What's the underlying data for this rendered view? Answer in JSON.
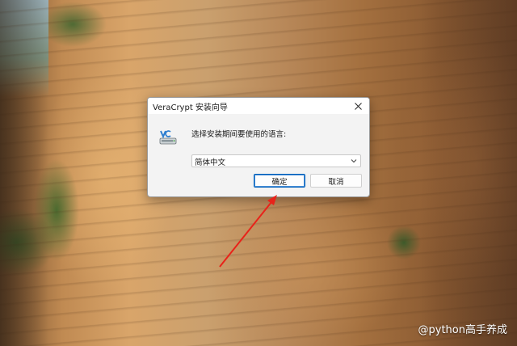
{
  "dialog": {
    "title": "VeraCrypt 安装向导",
    "prompt": "选择安装期间要使用的语言:",
    "language": {
      "selected": "简体中文"
    },
    "buttons": {
      "ok_label": "确定",
      "cancel_label": "取消"
    },
    "close_icon": "close-icon",
    "app_icon": "veracrypt-installer-icon"
  },
  "watermark": "@python高手养成",
  "annotation": {
    "arrow_color": "#e8231a"
  },
  "colors": {
    "ok_border": "#005fb8",
    "dialog_bg": "#f3f3f3"
  }
}
